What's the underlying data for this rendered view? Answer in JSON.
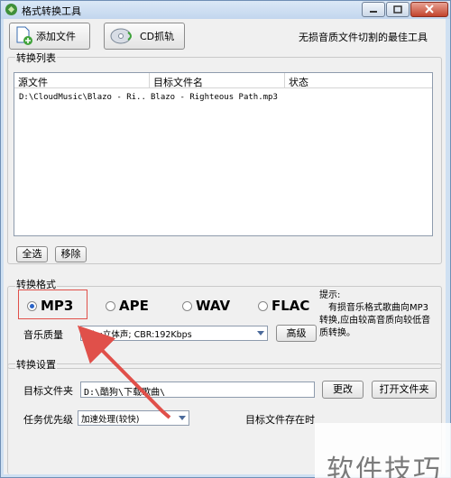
{
  "window": {
    "title": "格式转换工具"
  },
  "toolbar": {
    "add_files_label": "添加文件",
    "cd_rip_label": "CD抓轨",
    "slogan": "无损音质文件切割的最佳工具"
  },
  "file_list": {
    "group_label": "转换列表",
    "columns": [
      "源文件",
      "目标文件名",
      "状态"
    ],
    "rows": [
      {
        "source": "D:\\CloudMusic\\Blazo - Ri..",
        "target": "Blazo - Righteous Path.mp3",
        "status": ""
      }
    ],
    "select_all_label": "全选",
    "remove_label": "移除"
  },
  "format": {
    "group_label": "转换格式",
    "options": [
      "MP3",
      "APE",
      "WAV",
      "FLAC"
    ],
    "selected": "MP3",
    "quality_label": "音乐质量",
    "quality_value": "ode:立体声; CBR:192Kbps",
    "advanced_label": "高级",
    "hint_title": "提示:",
    "hint_body": "有损音乐格式歌曲向MP3转换,应由较高音质向较低音质转换。"
  },
  "settings": {
    "group_label": "转换设置",
    "target_folder_label": "目标文件夹",
    "target_folder_value": "D:\\酷狗\\下载歌曲\\",
    "change_label": "更改",
    "open_folder_label": "打开文件夹",
    "priority_label": "任务优先级",
    "priority_value": "加速处理(较快)",
    "exists_label": "目标文件存在时"
  },
  "watermark": {
    "text": "软件技巧"
  },
  "colors": {
    "highlight": "#e0504a",
    "arrow": "#e0504a",
    "title_bar": "#cfe0f2"
  }
}
